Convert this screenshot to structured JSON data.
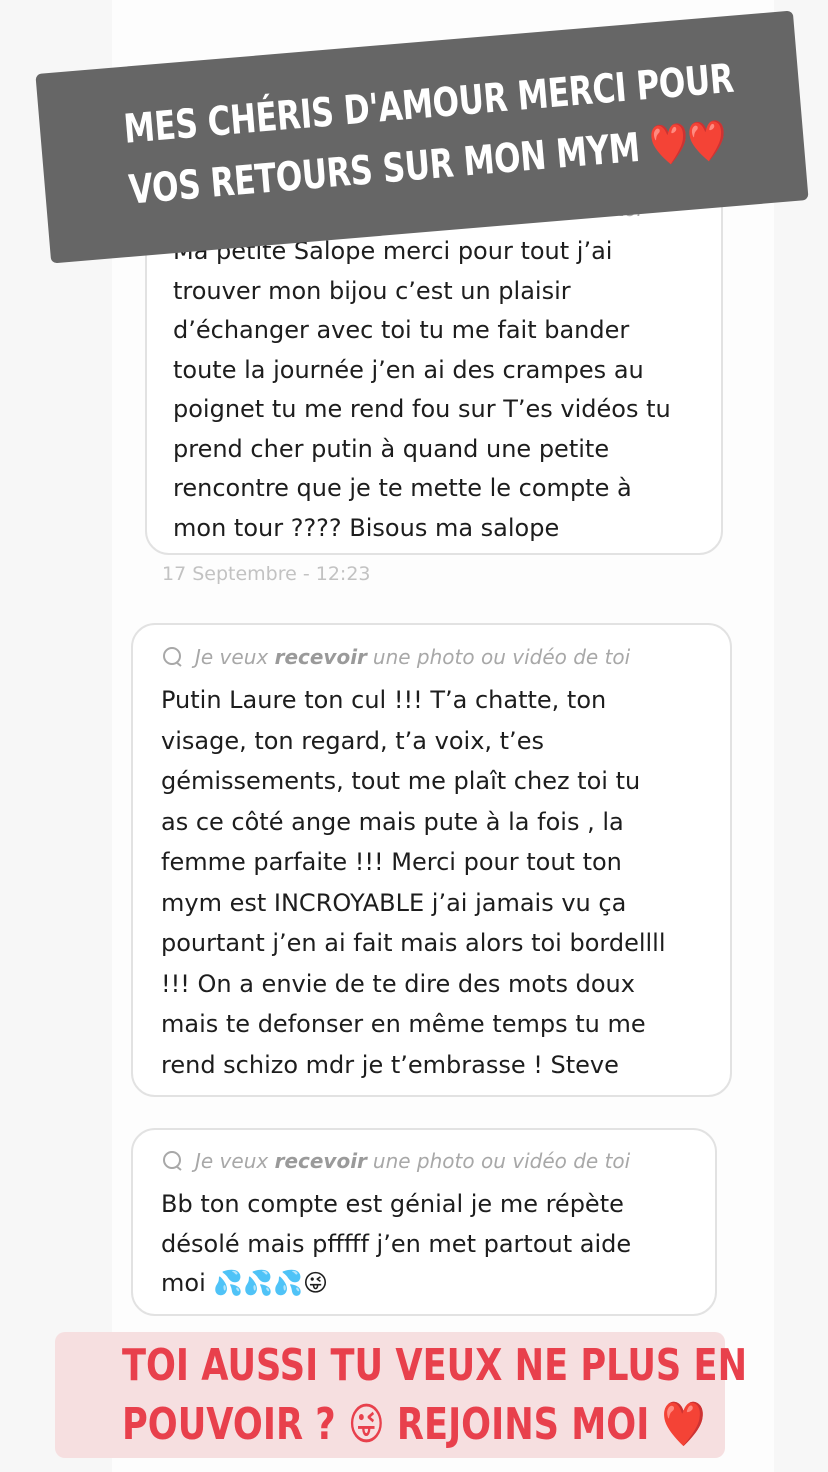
{
  "request_label": {
    "prefix": "Je veux",
    "keyword": "recevoir",
    "suffix": "une photo ou vidéo de toi"
  },
  "messages": [
    {
      "lines": [
        "Ma petite Salope merci pour tout j’ai",
        "trouver mon bijou c’est un plaisir",
        "d’échanger avec toi tu me fait bander",
        "toute la journée j’en ai des crampes au",
        "poignet tu me rend fou sur T’es vidéos tu",
        "prend cher putin à quand une petite",
        "rencontre que je te mette le compte à",
        "mon tour ???? Bisous ma salope"
      ],
      "date": "17 Septembre - 12:23"
    },
    {
      "lines": [
        "Putin Laure ton cul !!! T’a chatte, ton",
        "visage, ton regard, t’a voix, t’es",
        "gémissements, tout me plaît chez toi tu",
        "as ce côté ange mais pute à la fois , la",
        "femme parfaite !!! Merci pour tout ton",
        "mym est INCROYABLE j’ai jamais vu ça",
        "pourtant j’en ai fait mais alors toi bordellll",
        "!!! On a envie de te dire des mots doux",
        "mais te defonser en même temps tu me",
        "rend schizo mdr je t’embrasse ! Steve"
      ]
    },
    {
      "lines": [
        "Bb ton compte est génial je me répète",
        "désolé mais pfffff j’en met partout aide",
        "moi 💦💦💦😜"
      ]
    }
  ],
  "top_banner": {
    "line1": "MES CHÉRIS D'AMOUR MERCI POUR",
    "line2": "VOS RETOURS SUR MON MYM ❤️❤️"
  },
  "bottom_banner": {
    "line1": "TOI AUSSI TU VEUX NE PLUS EN",
    "line2": "POUVOIR ? 😜 REJOINS MOI ❤️"
  },
  "icons": {
    "request": "speech-bubble-icon"
  },
  "colors": {
    "top_banner_bg": "#666666",
    "bottom_banner_bg": "#f6dfe0",
    "bottom_banner_text": "#e8404c"
  }
}
